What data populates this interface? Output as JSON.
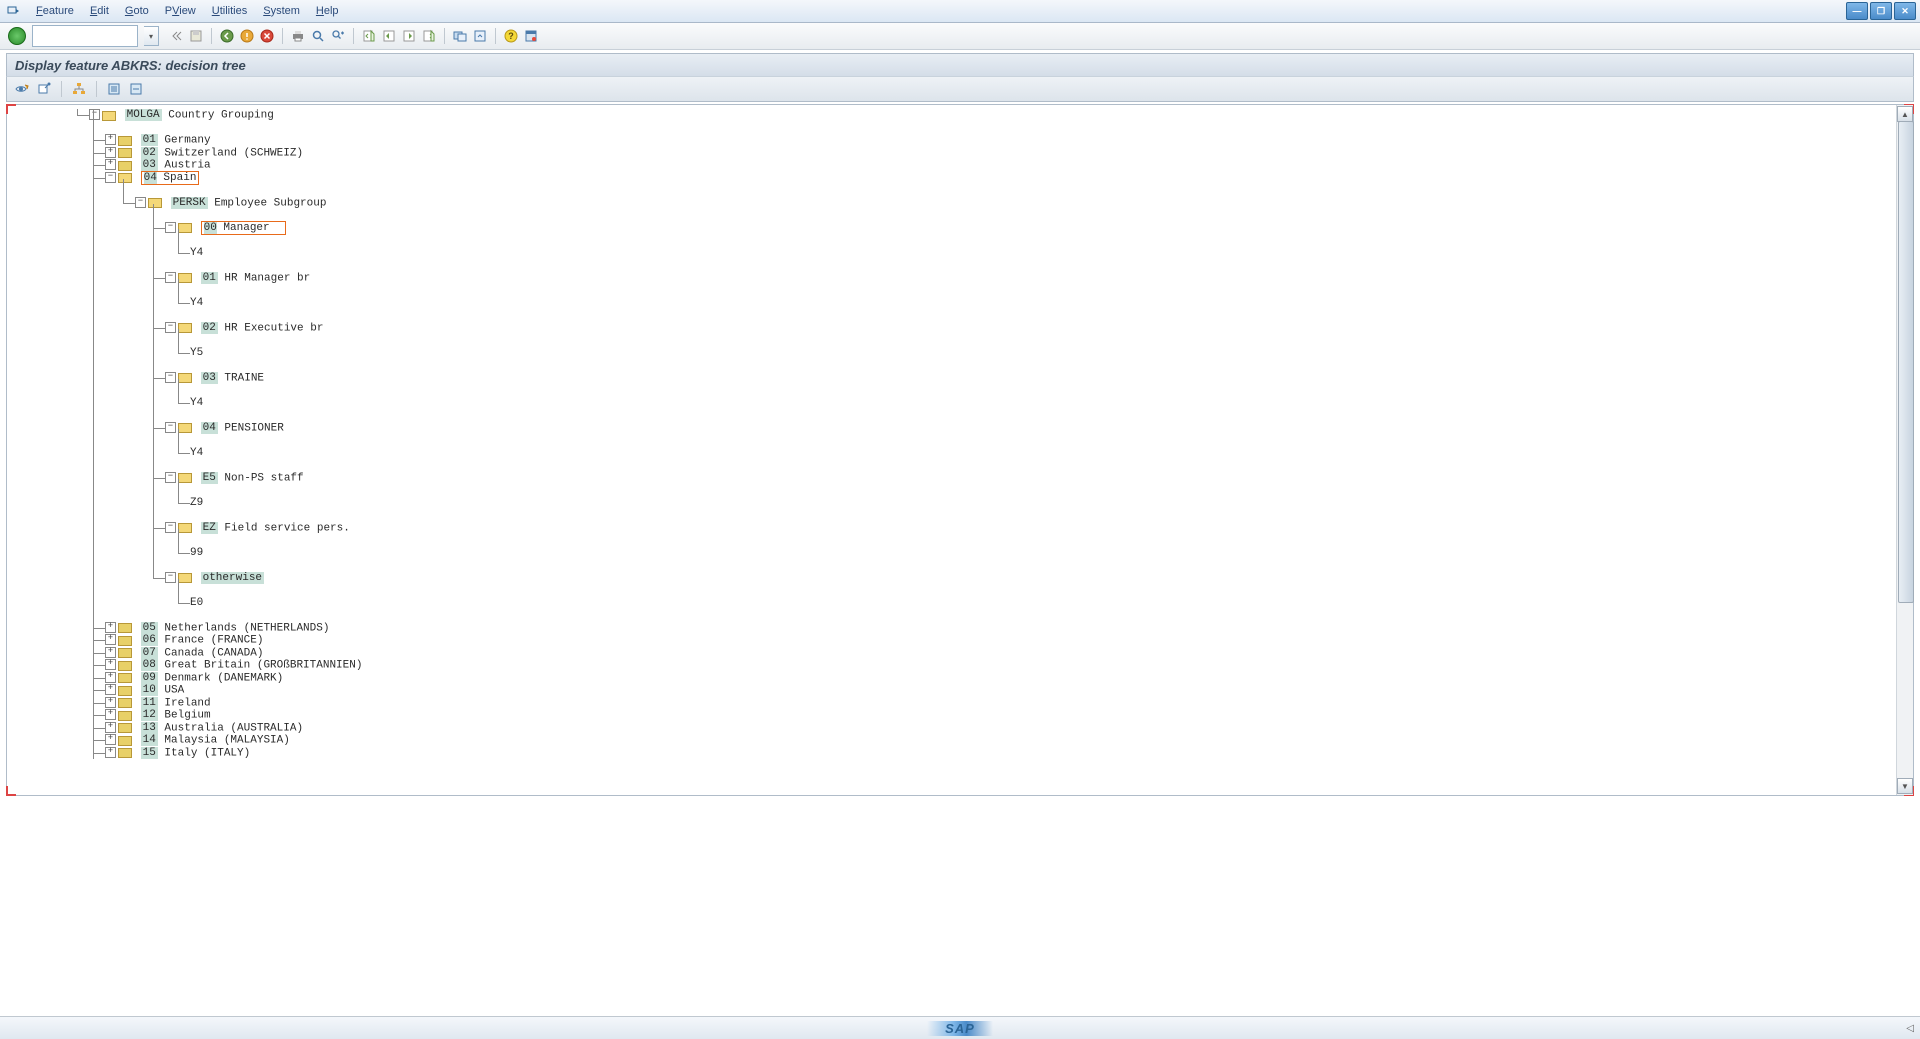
{
  "menu": {
    "items": [
      "Feature",
      "Edit",
      "Goto",
      "PView",
      "Utilities",
      "System",
      "Help"
    ],
    "underlines": [
      "F",
      "E",
      "G",
      "V",
      "U",
      "S",
      "H"
    ]
  },
  "title": "Display feature ABKRS: decision tree",
  "tree": {
    "root_code": "MOLGA",
    "root_label": "Country Grouping",
    "countries_top": [
      {
        "code": "01",
        "label": "Germany"
      },
      {
        "code": "02",
        "label": "Switzerland (SCHWEIZ)"
      },
      {
        "code": "03",
        "label": "Austria"
      }
    ],
    "spain": {
      "code": "04",
      "label": "Spain"
    },
    "persk": {
      "code": "PERSK",
      "label": "Employee Subgroup"
    },
    "subgroups": [
      {
        "code": "00",
        "label": "Manager",
        "ret": "Y4",
        "hl": true
      },
      {
        "code": "01",
        "label": "HR Manager br",
        "ret": "Y4"
      },
      {
        "code": "02",
        "label": "HR Executive br",
        "ret": "Y5"
      },
      {
        "code": "03",
        "label": "TRAINE",
        "ret": "Y4"
      },
      {
        "code": "04",
        "label": "PENSIONER",
        "ret": "Y4"
      },
      {
        "code": "E5",
        "label": "Non-PS staff",
        "ret": "Z9"
      },
      {
        "code": "EZ",
        "label": "Field service pers.",
        "ret": "99"
      },
      {
        "code": "otherwise",
        "label": "",
        "ret": "E0",
        "otherwise": true
      }
    ],
    "countries_bottom": [
      {
        "code": "05",
        "label": "Netherlands (NETHERLANDS)"
      },
      {
        "code": "06",
        "label": "France (FRANCE)"
      },
      {
        "code": "07",
        "label": "Canada (CANADA)"
      },
      {
        "code": "08",
        "label": "Great Britain (GROßBRITANNIEN)"
      },
      {
        "code": "09",
        "label": "Denmark (DANEMARK)"
      },
      {
        "code": "10",
        "label": "USA"
      },
      {
        "code": "11",
        "label": "Ireland"
      },
      {
        "code": "12",
        "label": "Belgium"
      },
      {
        "code": "13",
        "label": "Australia (AUSTRALIA)"
      },
      {
        "code": "14",
        "label": "Malaysia (MALAYSIA)"
      },
      {
        "code": "15",
        "label": "Italy (ITALY)"
      }
    ]
  },
  "icons": {
    "std": [
      "back",
      "exit",
      "cancel",
      "sep",
      "print",
      "find",
      "find-next",
      "sep",
      "first-page",
      "prev-page",
      "next-page",
      "last-page",
      "sep",
      "create-session",
      "generate",
      "sep",
      "help",
      "layout"
    ],
    "app": [
      "display-change",
      "check",
      "sep",
      "neighbor",
      "sep",
      "expand-all",
      "collapse-all"
    ]
  },
  "colors": {
    "accent": "#2a6496",
    "highlight_border": "#e86a1a",
    "folder": "#f4d878",
    "code_bg": "#c8e0d8"
  }
}
